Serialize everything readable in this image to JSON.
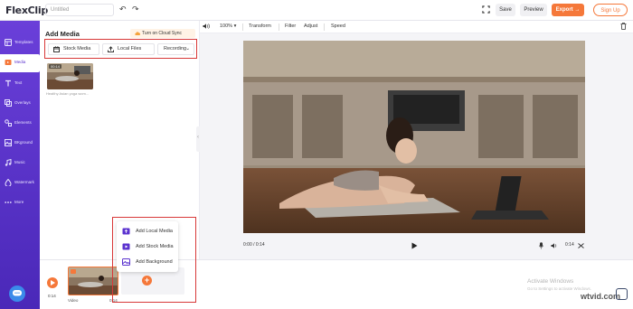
{
  "app": {
    "logo": "FlexClip",
    "project_title_placeholder": "Untitled",
    "undo_icon": "undo-icon",
    "redo_icon": "redo-icon",
    "save_label": "Save",
    "preview_label": "Preview",
    "export_label": "Export",
    "signup_label": "Sign Up",
    "accent_color": "#f5783a",
    "nav_color": "#5b33cf"
  },
  "sidebar": {
    "items": [
      {
        "label": "Templates",
        "icon": "templates-icon"
      },
      {
        "label": "Media",
        "icon": "media-icon"
      },
      {
        "label": "Text",
        "icon": "text-icon"
      },
      {
        "label": "Overlays",
        "icon": "overlays-icon"
      },
      {
        "label": "Elements",
        "icon": "elements-icon"
      },
      {
        "label": "BKground",
        "icon": "background-icon"
      },
      {
        "label": "Music",
        "icon": "music-icon"
      },
      {
        "label": "Watermark",
        "icon": "watermark-icon"
      },
      {
        "label": "More",
        "icon": "more-icon"
      }
    ],
    "active_index": 1
  },
  "media_panel": {
    "title": "Add Media",
    "cloud_sync_label": "Turn on Cloud Sync",
    "tabs": {
      "stock": "Stock Media",
      "local": "Local Files",
      "recording": "Recording"
    },
    "thumbnail": {
      "duration": "00:14",
      "caption": "Healthy Asian yoga wom..."
    }
  },
  "popup": {
    "items": [
      {
        "label": "Add Local Media",
        "icon": "local-media-icon"
      },
      {
        "label": "Add Stock Media",
        "icon": "stock-media-icon"
      },
      {
        "label": "Add Background",
        "icon": "background-icon"
      }
    ]
  },
  "toolbar": {
    "zoom": "100% ▾",
    "transform": "Transform",
    "filter": "Filter",
    "adjust": "Adjust",
    "speed": "Speed"
  },
  "player": {
    "current_time": "0:00 / 0:14",
    "duration": "0:14"
  },
  "timeline": {
    "time": "0:14",
    "clip_label": "Video",
    "clip_duration": "0:14"
  },
  "overlay": {
    "activate_title": "Activate Windows",
    "activate_sub": "Go to Settings to activate Windows.",
    "watermark": "wtvid.com"
  }
}
